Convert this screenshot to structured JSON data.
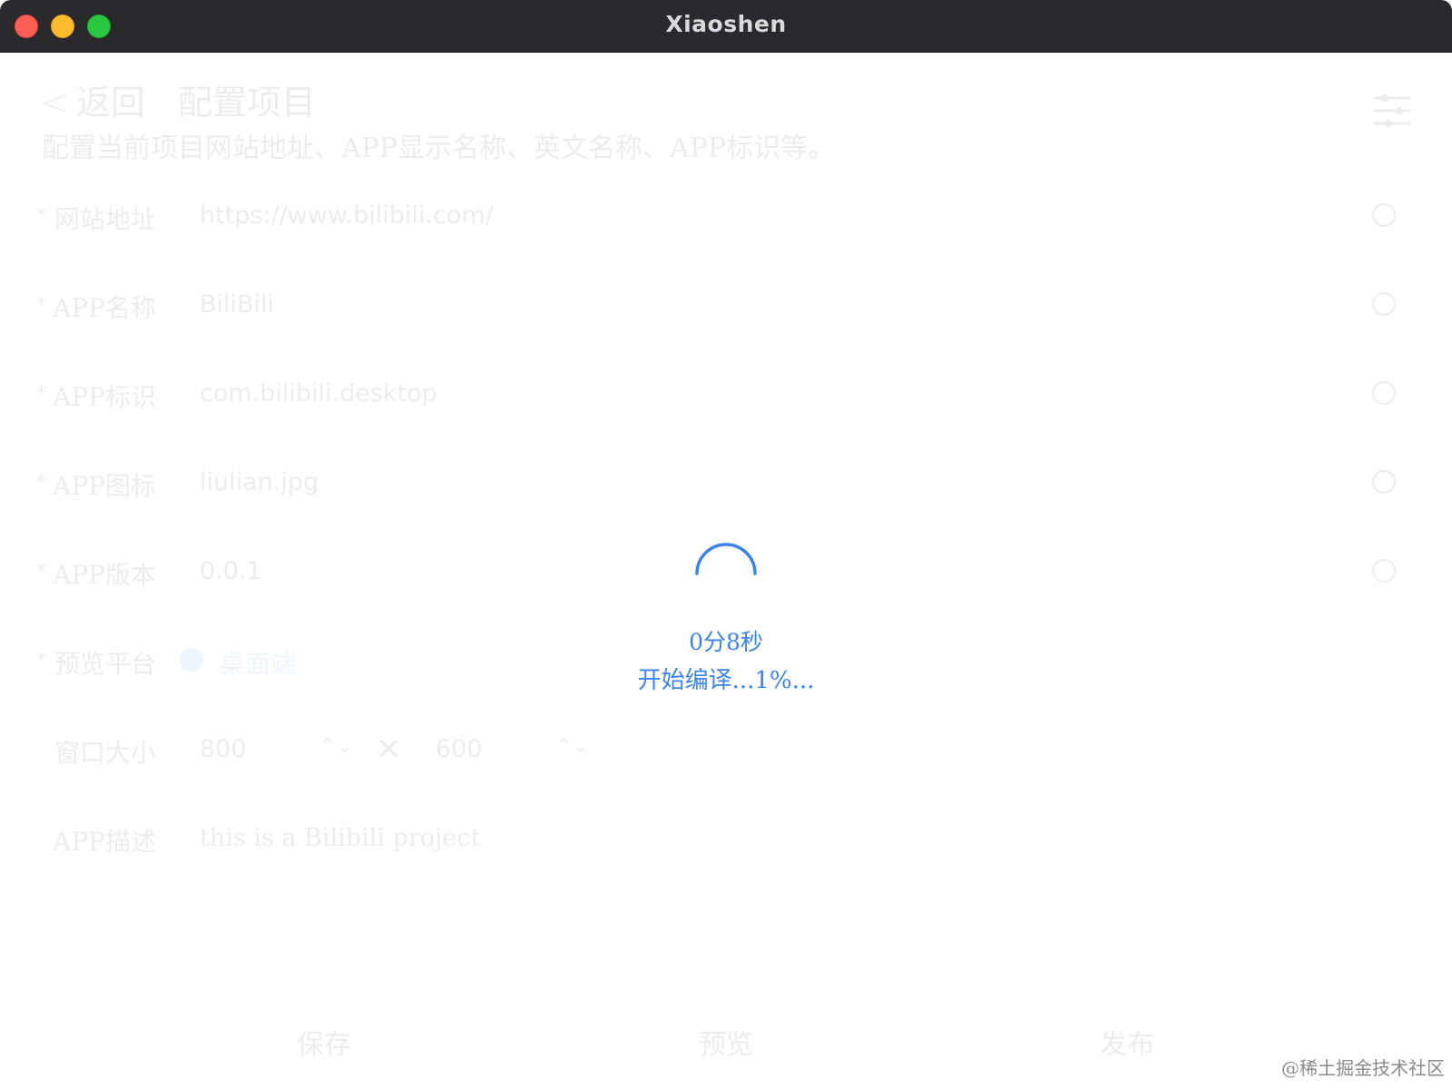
{
  "window": {
    "title": "Xiaoshen"
  },
  "header": {
    "back_label": "返回",
    "title": "配置项目",
    "subtitle": "配置当前项目网站地址、APP显示名称、英文名称、APP标识等。",
    "settings_icon": "sliders-icon"
  },
  "form": {
    "required_mark": "*",
    "website": {
      "label": "网站地址",
      "value": "https://www.bilibili.com/"
    },
    "app_name": {
      "label": "APP名称",
      "value": "BiliBili"
    },
    "app_id": {
      "label": "APP标识",
      "value": "com.bilibili.desktop"
    },
    "app_icon": {
      "label": "APP图标",
      "value": "liulian.jpg"
    },
    "app_version": {
      "label": "APP版本",
      "value": "0.0.1"
    },
    "platform": {
      "label": "预览平台",
      "option": "桌面端"
    },
    "window_size": {
      "label": "窗口大小",
      "width": "800",
      "height": "600",
      "separator": "✕",
      "stepper": "⌃⌄"
    },
    "description": {
      "label": "APP描述",
      "value": "this is a Bilibili project"
    }
  },
  "footer": {
    "save": "保存",
    "preview": "预览",
    "publish": "发布"
  },
  "loading": {
    "elapsed": "0分8秒",
    "message": "开始编译...1%...",
    "accent_color": "#3e83e8"
  },
  "watermark": "@稀土掘金技术社区"
}
